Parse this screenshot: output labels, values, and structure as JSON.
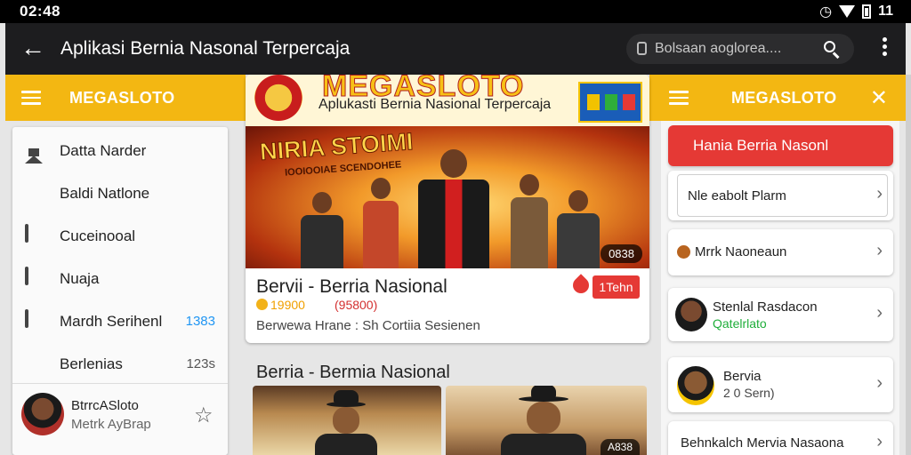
{
  "status_bar": {
    "time": "02:48",
    "battery_text": "11"
  },
  "app_bar": {
    "title": "Aplikasi Bernia Nasonal Terpercaja",
    "search_placeholder": "Bolsaan aoglorea...."
  },
  "left_header": {
    "title": "MEGASLOTO"
  },
  "right_header": {
    "title": "MEGASLOTO"
  },
  "drawer": {
    "items": [
      {
        "label": "Datta Narder",
        "icon": "home-icon",
        "count": ""
      },
      {
        "label": "Baldi Natlone",
        "icon": "inbox-icon",
        "count": ""
      },
      {
        "label": "Cuceinooal",
        "icon": "chat-icon",
        "count": ""
      },
      {
        "label": "Nuaja",
        "icon": "doc-icon",
        "count": ""
      },
      {
        "label": "Mardh Serihenl",
        "icon": "media-icon",
        "count": "1383"
      },
      {
        "label": "Berlenias",
        "icon": "list-icon",
        "count": "123s"
      }
    ],
    "user": {
      "name": "BtrrcASloto",
      "subtitle": "Metrk AyBrap"
    }
  },
  "center_card": {
    "banner_brand": "MEGASLOTO",
    "banner_tagline": "Aplukasti Bernia Nasional Terpercaja",
    "hero_headline": "NIRIA STOIMI",
    "hero_sub": "IOOIOOIAE SCENDOHEE",
    "hero_chip": "0838",
    "title": "Bervii - Berria Nasional",
    "price": "19900",
    "price_alt": "(95800)",
    "description": "Berwewa Hrane : Sh Cortiia Sesienen",
    "hot_badge": "1Tehn"
  },
  "section": {
    "title": "Berria - Bermia Nasional",
    "thumb_chip": "A838"
  },
  "right_panel": {
    "red_button": "Hania Berria Nasonl",
    "items": [
      {
        "title": "Nle eabolt Plarm",
        "subtitle": ""
      },
      {
        "title": "Mrrk Naoneaun",
        "subtitle": ""
      },
      {
        "title": "Stenlal Rasdacon",
        "subtitle": "Qatelrlato"
      },
      {
        "title": "Bervia",
        "subtitle": "2 0 Sern)"
      },
      {
        "title": "Behnkalch Mervia Nasaona",
        "subtitle": ""
      }
    ]
  },
  "colors": {
    "accent": "#f3b712",
    "danger": "#e53935",
    "dark": "#1d1d1f",
    "positive": "#1fae3a",
    "count_blue": "#2196f3"
  }
}
